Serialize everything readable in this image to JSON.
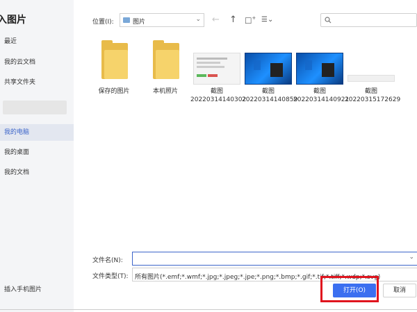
{
  "dialog": {
    "title": "入图片"
  },
  "sidebar": {
    "items": [
      {
        "label": "最近"
      },
      {
        "label": "我的云文档"
      },
      {
        "label": "共享文件夹"
      },
      {
        "label": "我的电脑"
      },
      {
        "label": "我的桌面"
      },
      {
        "label": "我的文档"
      }
    ],
    "bottom_label": "插入手机图片"
  },
  "toolbar": {
    "location_label": "位置(I):",
    "location_value": "图片",
    "icons": [
      "back-arrow-icon",
      "up-arrow-icon",
      "new-folder-icon",
      "view-options-icon",
      "search-icon"
    ]
  },
  "files": [
    {
      "name": "保存的图片",
      "kind": "folder"
    },
    {
      "name": "本机照片",
      "kind": "folder"
    },
    {
      "name": "截图\n20220314140302",
      "kind": "screenshot-light"
    },
    {
      "name": "截图\n20220314140859",
      "kind": "screenshot-blue"
    },
    {
      "name": "截图\n20220314140921",
      "kind": "screenshot-blue"
    },
    {
      "name": "截图\n20220315172629",
      "kind": "screenshot-thin"
    }
  ],
  "form": {
    "filename_label": "文件名(N):",
    "filename_value": "",
    "filetype_label": "文件类型(T):",
    "filetype_value": "所有图片(*.emf;*.wmf;*.jpg;*.jpeg;*.jpe;*.png;*.bmp;*.gif;*.tif;*.tiff;*.wdp;*.svg)"
  },
  "buttons": {
    "open": "打开(O)",
    "cancel": "取消"
  },
  "colors": {
    "accent": "#3b6ff0",
    "highlight": "#e0141e",
    "folder": "#f6d36b"
  }
}
